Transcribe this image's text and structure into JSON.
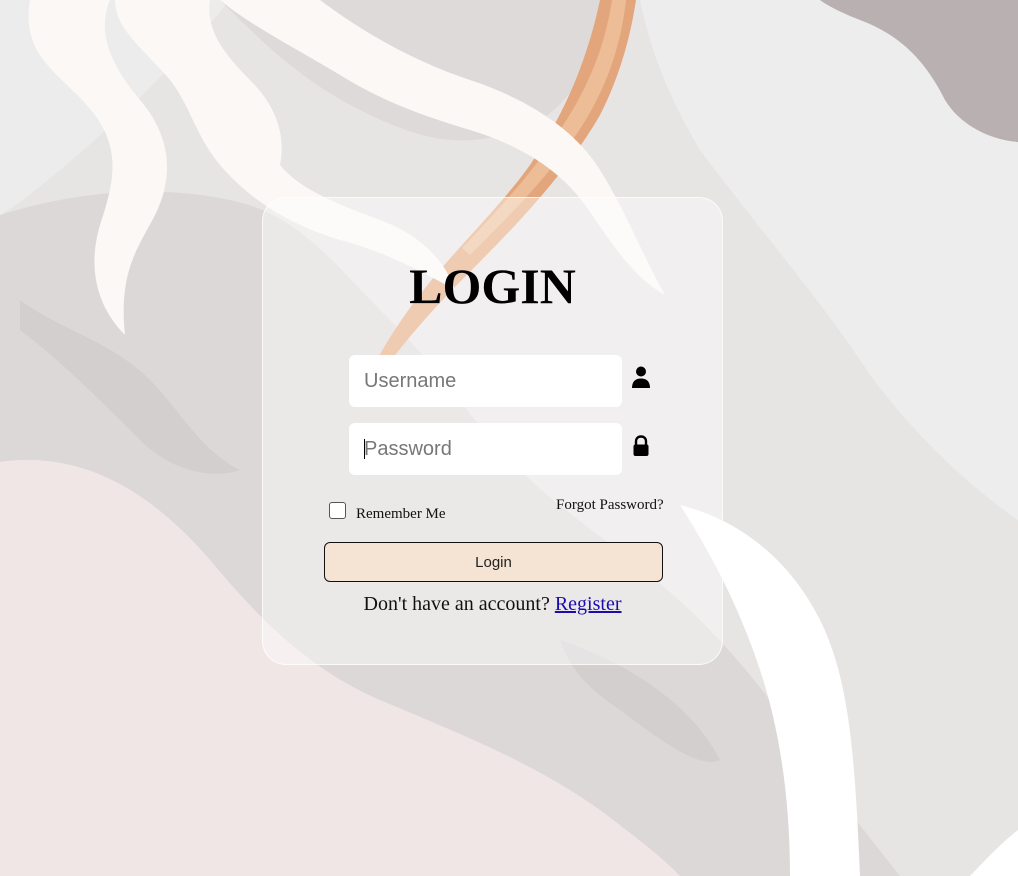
{
  "login_form": {
    "title": "LOGIN",
    "username": {
      "placeholder": "Username",
      "icon": "user-icon"
    },
    "password": {
      "placeholder": "Password",
      "icon": "lock-icon"
    },
    "remember_label": "Remember Me",
    "remember_checked": false,
    "forgot_label": "Forgot Password?",
    "submit_label": "Login",
    "register_prompt": "Don't have an account?",
    "register_link": "Register"
  },
  "colors": {
    "button_fill": "#f5e4d3",
    "link": "#1a0dab",
    "card": "rgba(255,255,255,0.42)"
  }
}
